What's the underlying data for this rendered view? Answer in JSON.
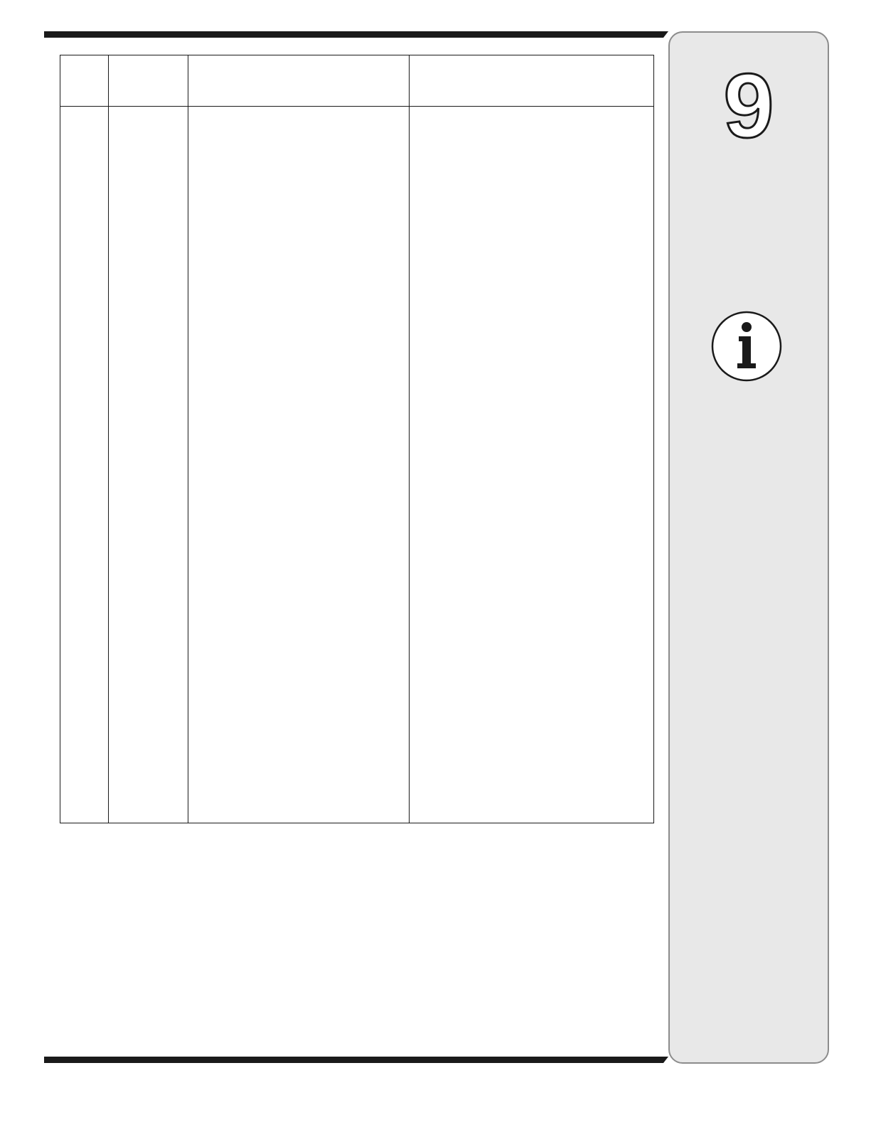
{
  "tab": {
    "chapter_number": "9",
    "icon": "info-icon"
  },
  "table": {
    "columns": [
      "",
      "",
      "",
      ""
    ],
    "rows": []
  },
  "colors": {
    "rule": "#1a1a1a",
    "tab_background": "#e8e8e8",
    "tab_border": "#8c8c8c"
  }
}
